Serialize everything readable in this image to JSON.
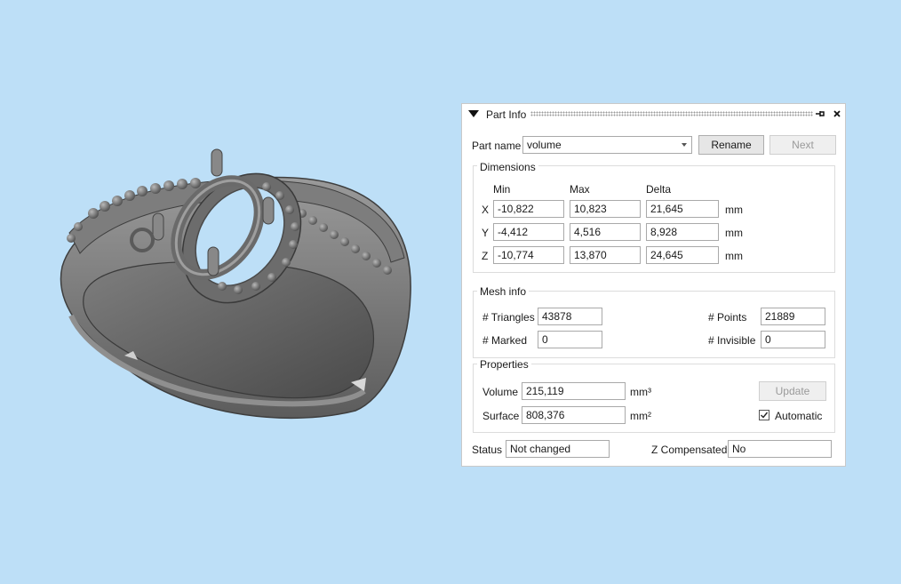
{
  "panel": {
    "title": "Part Info",
    "pin_icon": "pin-icon",
    "close_icon": "close-icon",
    "part_name_label": "Part name",
    "part_name_value": "volume",
    "rename_label": "Rename",
    "next_label": "Next"
  },
  "dimensions": {
    "title": "Dimensions",
    "col_min": "Min",
    "col_max": "Max",
    "col_delta": "Delta",
    "rows": [
      {
        "axis": "X",
        "min": "-10,822",
        "max": "10,823",
        "delta": "21,645",
        "unit": "mm"
      },
      {
        "axis": "Y",
        "min": "-4,412",
        "max": "4,516",
        "delta": "8,928",
        "unit": "mm"
      },
      {
        "axis": "Z",
        "min": "-10,774",
        "max": "13,870",
        "delta": "24,645",
        "unit": "mm"
      }
    ]
  },
  "mesh": {
    "title": "Mesh info",
    "triangles_label": "# Triangles",
    "triangles_value": "43878",
    "points_label": "# Points",
    "points_value": "21889",
    "marked_label": "# Marked",
    "marked_value": "0",
    "invisible_label": "# Invisible",
    "invisible_value": "0"
  },
  "properties": {
    "title": "Properties",
    "volume_label": "Volume",
    "volume_value": "215,119",
    "volume_unit": "mm³",
    "surface_label": "Surface",
    "surface_value": "808,376",
    "surface_unit": "mm²",
    "update_label": "Update",
    "automatic_label": "Automatic",
    "automatic_checked": true
  },
  "status": {
    "status_label": "Status",
    "status_value": "Not changed",
    "zcomp_label": "Z Compensated",
    "zcomp_value": "No"
  },
  "colors": {
    "background": "#bddff7",
    "model": "#6f6f6f"
  }
}
